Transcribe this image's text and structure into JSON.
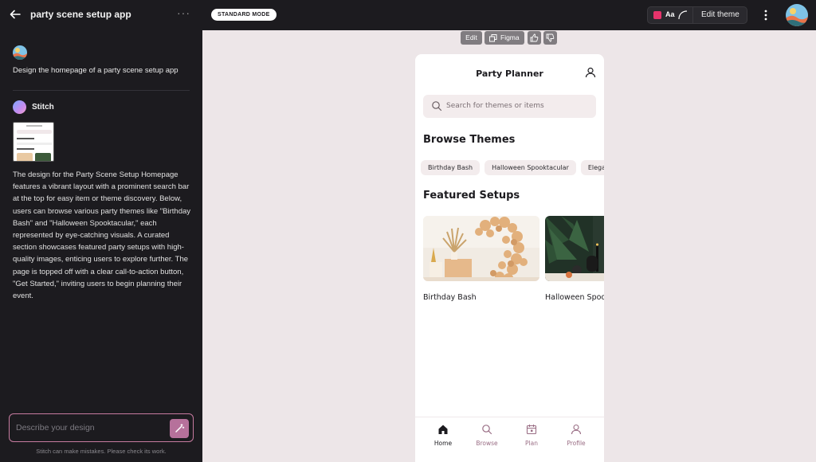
{
  "topbar": {
    "title": "party scene setup app",
    "more_label": "···",
    "mode": "STANDARD MODE",
    "font_label": "Aa",
    "edit_theme": "Edit theme",
    "accent_color": "#e6336b"
  },
  "chat": {
    "user_message": "Design the homepage of a party scene setup app",
    "assistant_name": "Stitch",
    "assistant_text": "The design for the Party Scene Setup Homepage features a vibrant layout with a prominent search bar at the top for easy item or theme discovery. Below, users can browse various party themes like \"Birthday Bash\" and \"Halloween Spooktacular,\" each represented by eye-catching visuals. A curated section showcases featured party setups with high-quality images, enticing users to explore further. The page is topped off with a clear call-to-action button, \"Get Started,\" inviting users to begin planning their event.",
    "input_placeholder": "Describe your design",
    "disclaimer": "Stitch can make mistakes. Please check its work."
  },
  "canvas_toolbar": {
    "edit": "Edit",
    "figma": "Figma"
  },
  "phone": {
    "title": "Party Planner",
    "search_placeholder": "Search for themes or items",
    "browse_heading": "Browse Themes",
    "themes": [
      "Birthday Bash",
      "Halloween Spooktacular",
      "Elegant Soirée"
    ],
    "featured_heading": "Featured Setups",
    "setups": [
      {
        "label": "Birthday Bash"
      },
      {
        "label": "Halloween Spooktacular"
      }
    ],
    "nav": [
      {
        "label": "Home",
        "icon": "home-icon",
        "active": true
      },
      {
        "label": "Browse",
        "icon": "search-icon",
        "active": false
      },
      {
        "label": "Plan",
        "icon": "calendar-icon",
        "active": false
      },
      {
        "label": "Profile",
        "icon": "user-icon",
        "active": false
      }
    ]
  }
}
